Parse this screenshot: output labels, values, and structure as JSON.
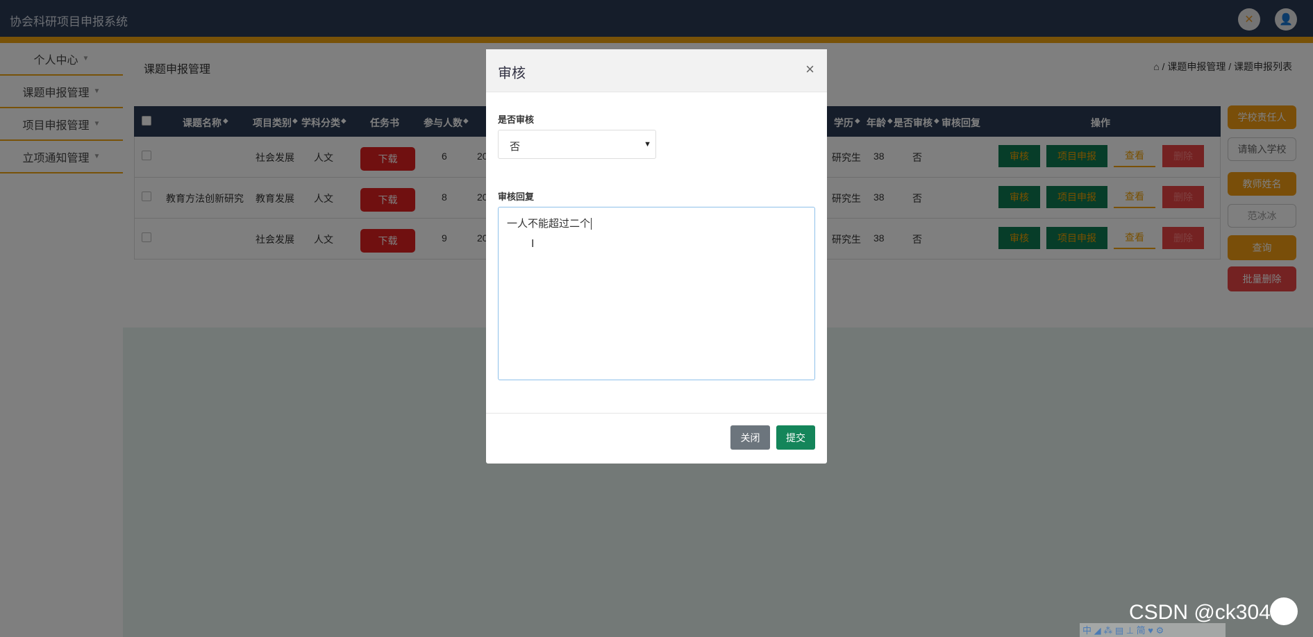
{
  "header": {
    "app_title": "协会科研项目申报系统"
  },
  "sidebar": {
    "items": [
      {
        "label": "个人中心"
      },
      {
        "label": "课题申报管理"
      },
      {
        "label": "项目申报管理"
      },
      {
        "label": "立项通知管理"
      }
    ]
  },
  "page": {
    "title": "课题申报管理",
    "breadcrumb": [
      "课题申报管理",
      "课题申报列表"
    ]
  },
  "table": {
    "columns": [
      "课题名称",
      "项目类别",
      "学科分类",
      "任务书",
      "参与人数",
      "学历",
      "年龄",
      "是否审核",
      "审核回复",
      "操作"
    ],
    "download_label": "下载",
    "rows": [
      {
        "name": "",
        "category": "社会发展",
        "discipline": "人文",
        "people": "6",
        "date": "20",
        "education": "研究生",
        "age": "38",
        "reviewed": "否"
      },
      {
        "name": "教育方法创新研究",
        "category": "教育发展",
        "discipline": "人文",
        "people": "8",
        "date": "20",
        "education": "研究生",
        "age": "38",
        "reviewed": "否"
      },
      {
        "name": "",
        "category": "社会发展",
        "discipline": "人文",
        "people": "9",
        "date": "20",
        "education": "研究生",
        "age": "38",
        "reviewed": "否"
      }
    ],
    "actions": {
      "review": "审核",
      "apply": "项目申报",
      "view": "查看",
      "delete": "删除"
    }
  },
  "right_panel": {
    "school_owner_label": "学校责任人",
    "school_input_placeholder": "请输入学校",
    "teacher_label": "教师姓名",
    "teacher_input_value": "范冰冰",
    "query": "查询",
    "batch_delete": "批量删除"
  },
  "modal": {
    "title": "审核",
    "close_x": "×",
    "field1_label": "是否审核",
    "field1_value": "否",
    "field2_label": "审核回复",
    "field2_value": "一人不能超过二个",
    "close_button": "关闭",
    "submit_button": "提交"
  },
  "watermark": "CSDN @ck3047",
  "ime_bar": "中 ◢ ⁂ ▤ ⊥ 简 ♥ ⚙",
  "colors": {
    "header": "#2b3a55",
    "accent": "#f0a510",
    "success": "#0f7a52",
    "danger": "#e02020"
  }
}
